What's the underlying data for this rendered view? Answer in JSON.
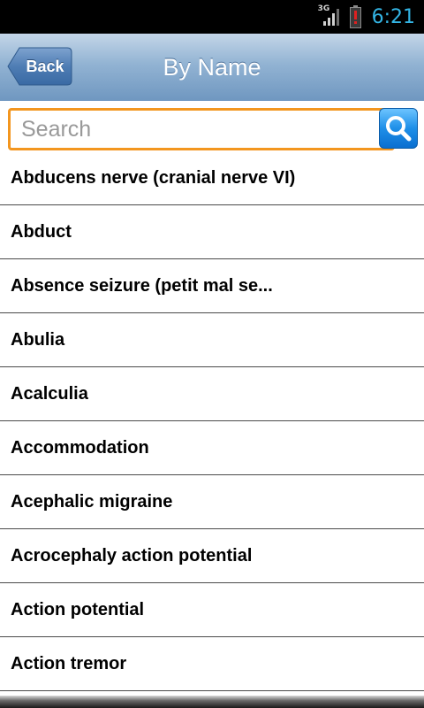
{
  "status_bar": {
    "network": "3G",
    "time": "6:21",
    "icons": [
      "signal-icon",
      "battery-alert-icon"
    ]
  },
  "header": {
    "back_label": "Back",
    "title": "By Name"
  },
  "search": {
    "placeholder": "Search",
    "value": "",
    "button_icon": "magnifier-icon"
  },
  "colors": {
    "accent_orange": "#f3961f",
    "header_blue": "#6f97c0",
    "search_blue": "#1e8fe8",
    "clock_blue": "#33b5e5"
  },
  "list": {
    "items": [
      "Abducens nerve (cranial nerve VI)",
      "Abduct",
      "Absence seizure (petit mal se...",
      "Abulia",
      "Acalculia",
      "Accommodation",
      "Acephalic migraine",
      "Acrocephaly action potential",
      "Action potential",
      "Action tremor"
    ]
  }
}
